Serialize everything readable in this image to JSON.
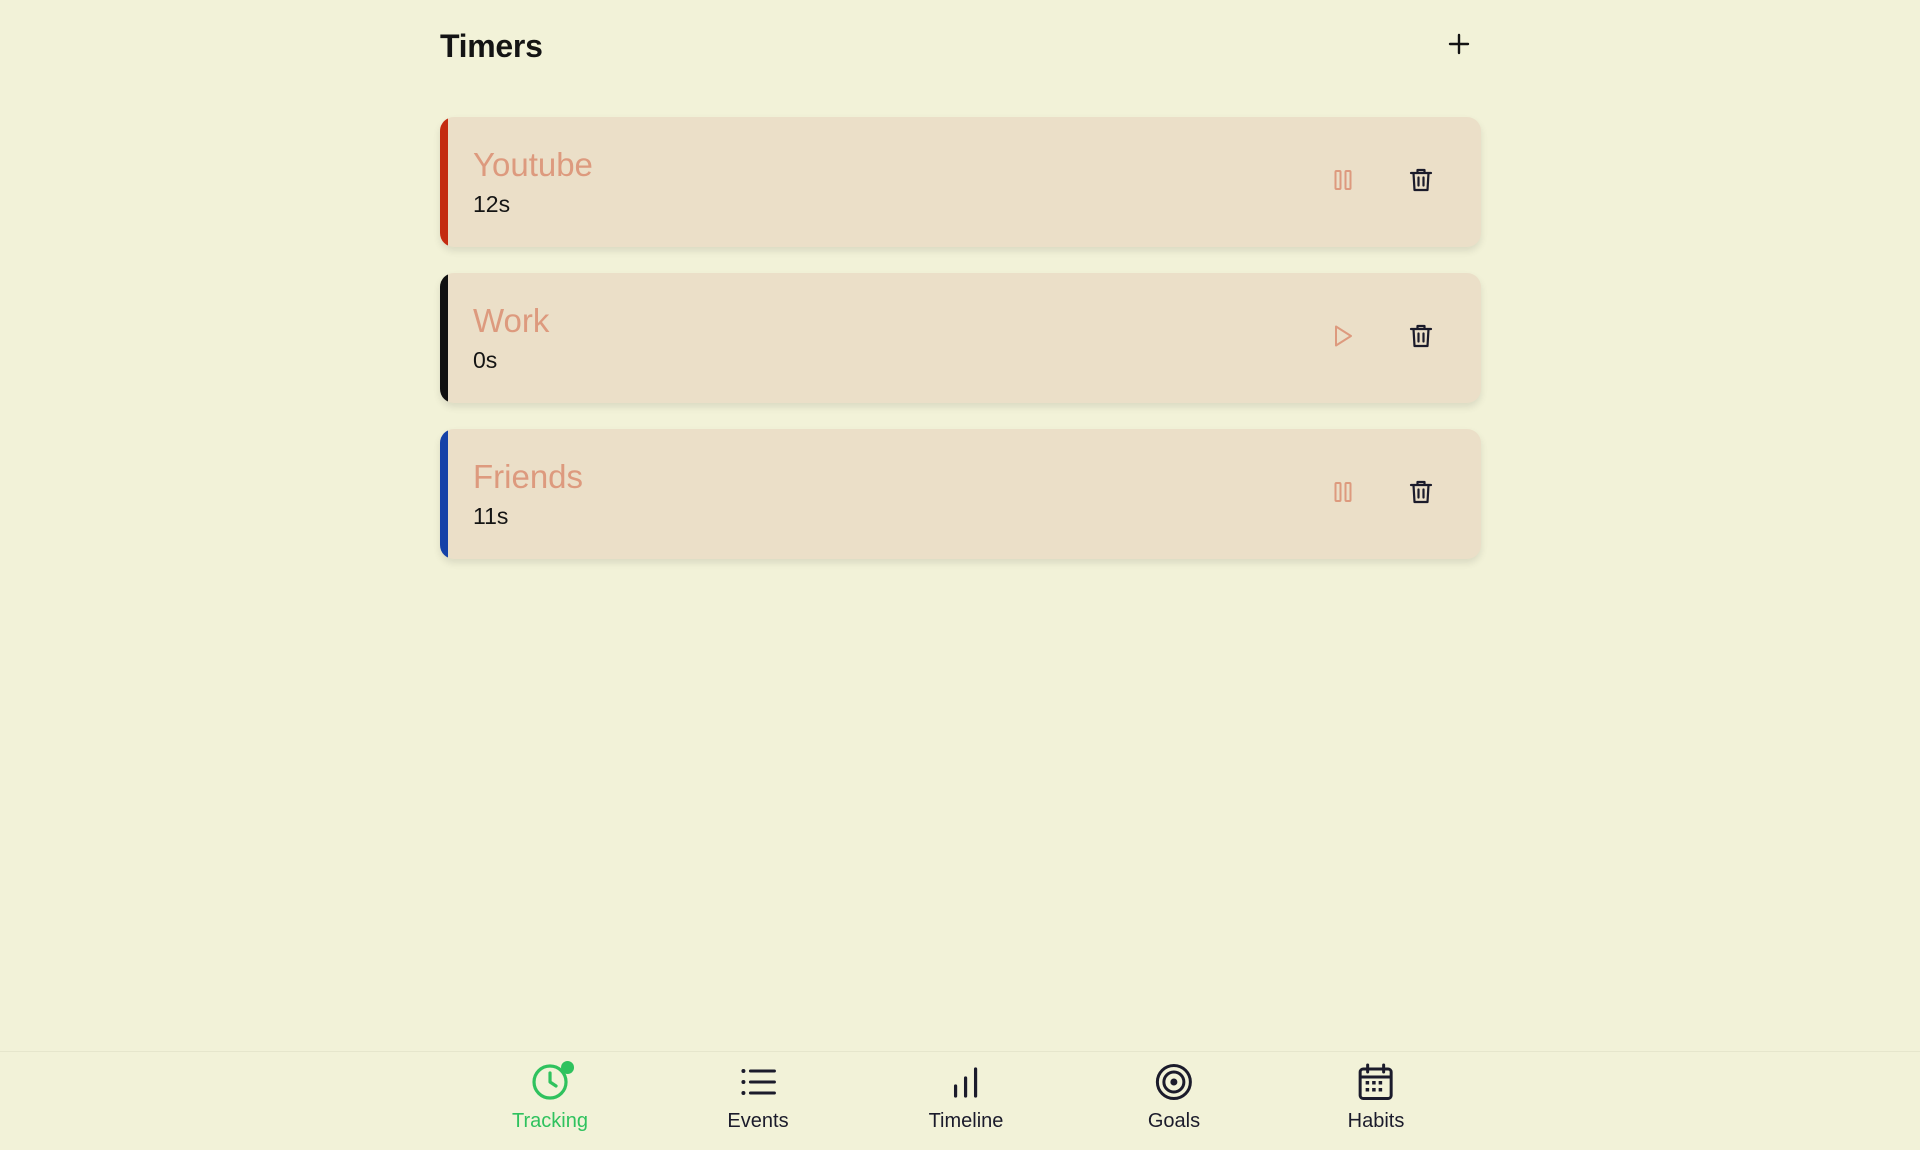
{
  "header": {
    "title": "Timers",
    "add_icon": "plus-icon"
  },
  "timers": [
    {
      "name": "Youtube",
      "elapsed": "12s",
      "accent": "#c42b10",
      "state": "running",
      "action_icon": "pause-icon"
    },
    {
      "name": "Work",
      "elapsed": "0s",
      "accent": "#111111",
      "state": "stopped",
      "action_icon": "play-icon"
    },
    {
      "name": "Friends",
      "elapsed": "11s",
      "accent": "#1542a8",
      "state": "running",
      "action_icon": "pause-icon"
    }
  ],
  "nav": {
    "items": [
      {
        "label": "Tracking",
        "icon": "clock-icon",
        "active": true,
        "badge": true
      },
      {
        "label": "Events",
        "icon": "list-icon",
        "active": false
      },
      {
        "label": "Timeline",
        "icon": "bar-chart-icon",
        "active": false
      },
      {
        "label": "Goals",
        "icon": "target-icon",
        "active": false
      },
      {
        "label": "Habits",
        "icon": "calendar-icon",
        "active": false
      }
    ]
  },
  "colors": {
    "background": "#f2f2d8",
    "card": "#ebdfc8",
    "timer_name": "#dd9a7e",
    "active_nav": "#2fc25e"
  }
}
